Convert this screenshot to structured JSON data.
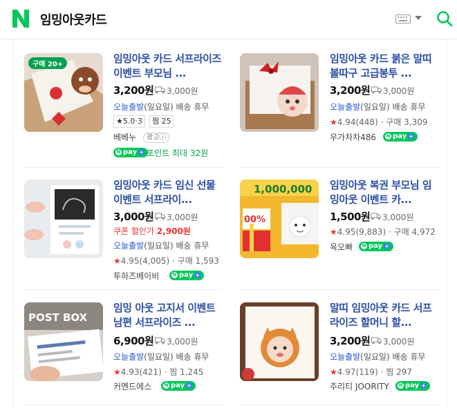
{
  "header": {
    "logo": "N",
    "title": "임밍아웃카드",
    "icons": [
      "keyboard-icon",
      "search-icon"
    ]
  },
  "products": [
    {
      "name": "임밍아웃 카드 서프라이즈 이벤트 부모님 ...",
      "thumb_badge": "구매 20+",
      "price": "3,200원",
      "shipping": "3,000원",
      "delivery_brand": "오늘출발",
      "delivery_note": "(일요일) 배송 휴무",
      "rating_box": "★5.0·3",
      "wish_box": "찜 25",
      "seller": "베베누",
      "ad": "광고ⓘ",
      "npay": "pay",
      "point": "포인트 최대 32원"
    },
    {
      "name": "임밍아웃 카드 붉은 말띠 볼따구 고급봉투 ...",
      "price": "3,200원",
      "shipping": "3,000원",
      "delivery_brand": "오늘출발",
      "delivery_note": "(일요일) 배송 휴무",
      "rating": "4.94",
      "reviews": "(448)",
      "buys": "구매 3,309",
      "seller": "우가차차486",
      "npay": "pay"
    },
    {
      "name": "임밍아웃 카드 임신 선물 이벤트 서프라이...",
      "price": "3,000원",
      "shipping": "3,000원",
      "coupon_label": "쿠폰 할인가",
      "coupon_price": "2,900원",
      "delivery_brand": "오늘출발",
      "delivery_note": "(일요일) 배송 휴무",
      "rating": "4.95",
      "reviews": "(4,005)",
      "buys": "구매 1,593",
      "seller": "투하즈베이비",
      "npay": "pay"
    },
    {
      "name": "임밍아웃 복권 부모님 임밍아웃 이벤트 카...",
      "price": "1,500원",
      "shipping": "3,000원",
      "rating": "4.95",
      "reviews": "(9,883)",
      "buys": "구매 4,972",
      "seller": "육오빠",
      "npay": "pay"
    },
    {
      "name": "임밍 아웃 고지서 이벤트 남편 서프라이즈 ...",
      "price": "6,900원",
      "shipping": "3,000원",
      "delivery_brand": "오늘출발",
      "delivery_note": "(일요일) 배송 휴무",
      "rating": "4.93",
      "reviews": "(421)",
      "buys": "찜 1,245",
      "seller": "커멘드에스",
      "npay": "pay"
    },
    {
      "name": "말띠 임밍아웃 카드 서프라이즈 할머니 할...",
      "price": "3,200원",
      "shipping": "3,000원",
      "delivery_brand": "오늘출발",
      "delivery_note": "(일요일) 배송 휴무",
      "rating": "4.97",
      "reviews": "(119)",
      "buys": "찜 297",
      "seller": "주리티 JOORITY",
      "npay": "pay"
    }
  ],
  "thumb_texts": {
    "lottery": "1,000,000",
    "postbox": "POST BOX",
    "coupon_pct": "00%"
  },
  "colors": {
    "naver_green": "#03c75a",
    "link_blue": "#2c4ea3",
    "star_red": "#e33333"
  }
}
